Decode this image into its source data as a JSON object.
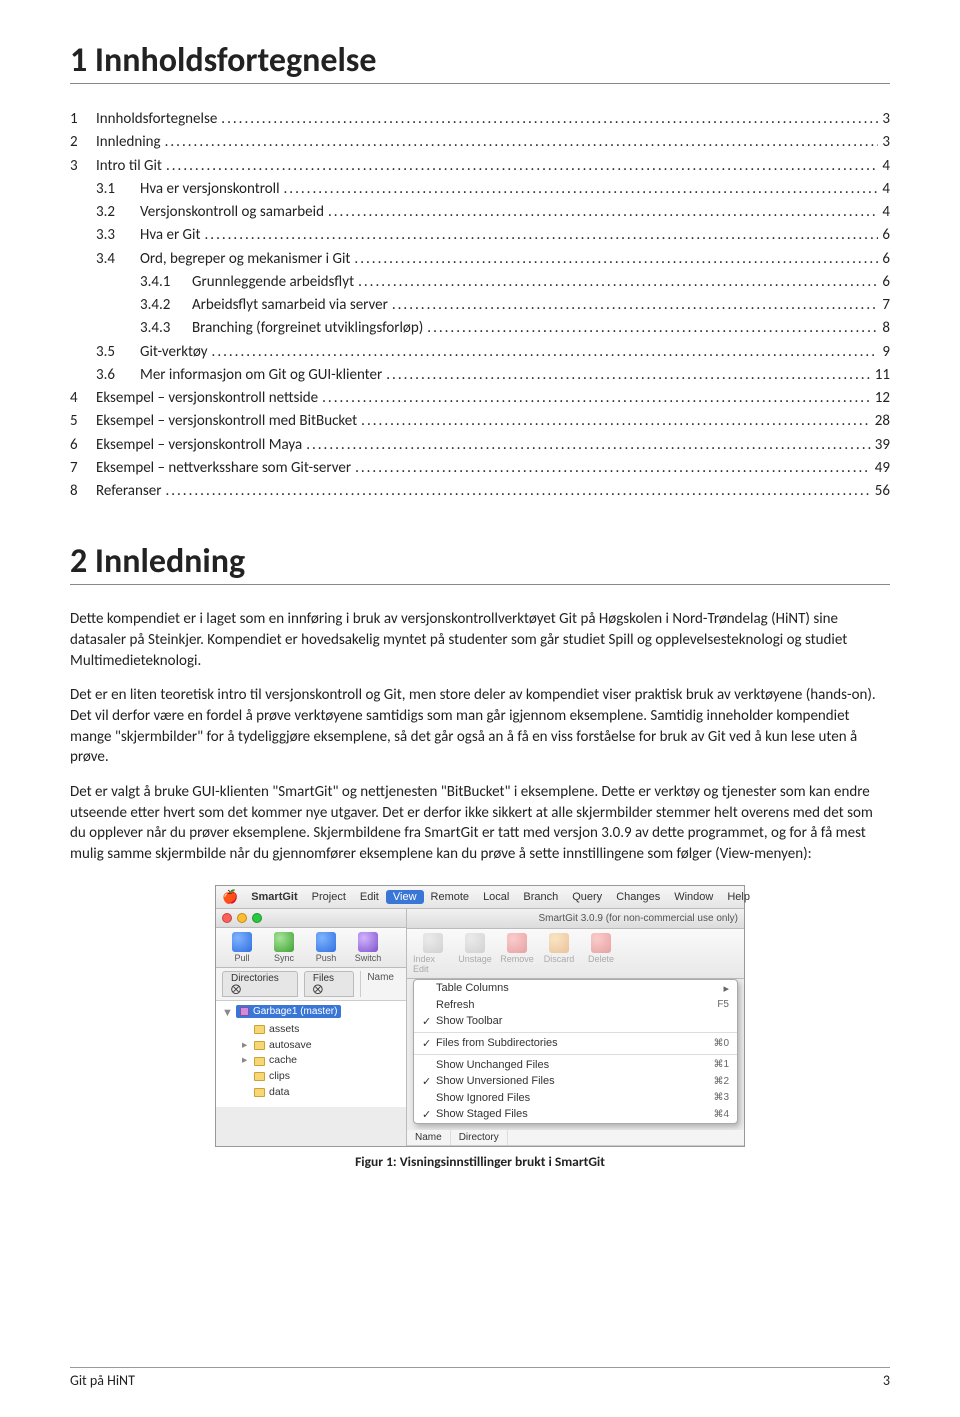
{
  "headings": {
    "h1_toc": "1  Innholdsfortegnelse",
    "h1_intro": "2  Innledning"
  },
  "toc": [
    {
      "lvl": 0,
      "num": "1",
      "label": "Innholdsfortegnelse",
      "page": "3"
    },
    {
      "lvl": 0,
      "num": "2",
      "label": "Innledning",
      "page": "3"
    },
    {
      "lvl": 0,
      "num": "3",
      "label": "Intro til Git",
      "page": "4"
    },
    {
      "lvl": 1,
      "num": "3.1",
      "label": "Hva er versjonskontroll",
      "page": "4"
    },
    {
      "lvl": 1,
      "num": "3.2",
      "label": "Versjonskontroll og samarbeid",
      "page": "4"
    },
    {
      "lvl": 1,
      "num": "3.3",
      "label": "Hva er Git",
      "page": "6"
    },
    {
      "lvl": 1,
      "num": "3.4",
      "label": "Ord, begreper og mekanismer i Git",
      "page": "6"
    },
    {
      "lvl": 2,
      "num": "3.4.1",
      "label": "Grunnleggende arbeidsflyt",
      "page": "6"
    },
    {
      "lvl": 2,
      "num": "3.4.2",
      "label": "Arbeidsflyt samarbeid via server",
      "page": "7"
    },
    {
      "lvl": 2,
      "num": "3.4.3",
      "label": "Branching (forgreinet utviklingsforløp)",
      "page": "8"
    },
    {
      "lvl": 1,
      "num": "3.5",
      "label": "Git-verktøy",
      "page": "9"
    },
    {
      "lvl": 1,
      "num": "3.6",
      "label": "Mer informasjon om Git og GUI-klienter",
      "page": "11"
    },
    {
      "lvl": 0,
      "num": "4",
      "label": "Eksempel – versjonskontroll nettside",
      "page": "12"
    },
    {
      "lvl": 0,
      "num": "5",
      "label": "Eksempel – versjonskontroll med BitBucket",
      "page": "28"
    },
    {
      "lvl": 0,
      "num": "6",
      "label": "Eksempel – versjonskontroll Maya",
      "page": "39"
    },
    {
      "lvl": 0,
      "num": "7",
      "label": "Eksempel – nettverksshare som Git-server",
      "page": "49"
    },
    {
      "lvl": 0,
      "num": "8",
      "label": "Referanser",
      "page": "56"
    }
  ],
  "paragraphs": {
    "p1": "Dette kompendiet er i laget som en innføring i bruk av versjonskontrollverktøyet Git på Høgskolen i Nord-Trøndelag (HiNT) sine datasaler på Steinkjer. Kompendiet er hovedsakelig myntet på studenter som går studiet Spill og opplevelsesteknologi og studiet Multimedieteknologi.",
    "p2": "Det er en liten teoretisk intro til versjonskontroll og Git, men store deler av kompendiet viser praktisk bruk av verktøyene (hands-on). Det vil derfor være en fordel å prøve verktøyene samtidigs som man går igjennom eksemplene. Samtidig inneholder kompendiet mange \"skjermbilder\" for å tydeliggjøre eksemplene, så det går også an å få en viss forståelse for bruk av Git ved å kun lese uten å prøve.",
    "p3": "Det er valgt å bruke GUI-klienten \"SmartGit\" og nettjenesten \"BitBucket\" i eksemplene. Dette er verktøy og tjenester som kan endre utseende etter hvert som det kommer nye utgaver. Det er derfor ikke sikkert at alle skjermbilder stemmer helt overens med det som du opplever når du prøver eksemplene. Skjermbildene fra SmartGit er tatt med versjon 3.0.9 av dette programmet, og for å få mest mulig samme skjermbilde når du gjennomfører eksemplene kan du prøve å sette innstillingene som følger (View-menyen):"
  },
  "figure": {
    "caption": "Figur 1: Visningsinnstillinger brukt i SmartGit",
    "menubar": {
      "app": "SmartGit",
      "items": [
        "Project",
        "Edit",
        "View",
        "Remote",
        "Local",
        "Branch",
        "Query",
        "Changes",
        "Window",
        "Help"
      ],
      "selected": "View"
    },
    "titlebar_right": "SmartGit 3.0.9 (for non-commercial use only)",
    "toolbar_left": [
      {
        "label": "Pull",
        "color": "blue"
      },
      {
        "label": "Sync",
        "color": "green"
      },
      {
        "label": "Push",
        "color": "blue"
      },
      {
        "label": "Switch",
        "color": "purple"
      }
    ],
    "toolbar_right": [
      {
        "label": "Index Edit",
        "color": "gray",
        "dim": true
      },
      {
        "label": "Unstage",
        "color": "gray",
        "dim": true
      },
      {
        "label": "Remove",
        "color": "red",
        "dim": true
      },
      {
        "label": "Discard",
        "color": "orange",
        "dim": true
      },
      {
        "label": "Delete",
        "color": "red",
        "dim": true
      }
    ],
    "left_tabs": [
      "Directories ⨂",
      "Files ⨂"
    ],
    "right_col_headers": [
      "Name",
      "Directory"
    ],
    "project": "Garbage1 (master)",
    "tree": [
      {
        "name": "assets",
        "expandable": false
      },
      {
        "name": "autosave",
        "expandable": true
      },
      {
        "name": "cache",
        "expandable": true
      },
      {
        "name": "clips",
        "expandable": false
      },
      {
        "name": "data",
        "expandable": false
      }
    ],
    "dropdown": [
      {
        "type": "item",
        "label": "Table Columns",
        "arrow": true
      },
      {
        "type": "item",
        "label": "Refresh",
        "shortcut": "F5"
      },
      {
        "type": "item",
        "label": "Show Toolbar",
        "checked": true
      },
      {
        "type": "sep"
      },
      {
        "type": "item",
        "label": "Files from Subdirectories",
        "checked": true,
        "shortcut": "⌘0"
      },
      {
        "type": "sep"
      },
      {
        "type": "item",
        "label": "Show Unchanged Files",
        "shortcut": "⌘1"
      },
      {
        "type": "item",
        "label": "Show Unversioned Files",
        "checked": true,
        "shortcut": "⌘2"
      },
      {
        "type": "item",
        "label": "Show Ignored Files",
        "shortcut": "⌘3"
      },
      {
        "type": "item",
        "label": "Show Staged Files",
        "checked": true,
        "shortcut": "⌘4"
      }
    ]
  },
  "footer": {
    "left": "Git på HiNT",
    "right": "3"
  }
}
